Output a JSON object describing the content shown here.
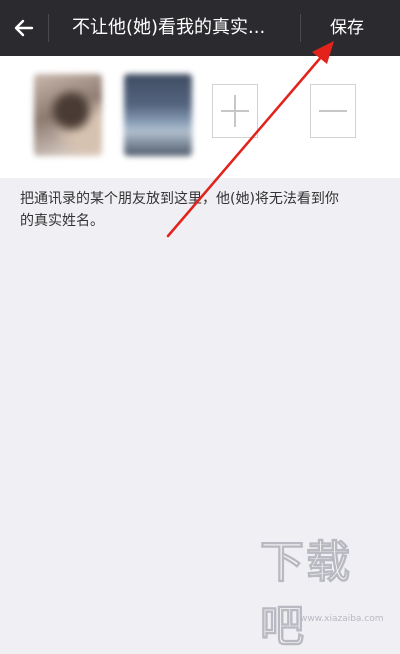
{
  "header": {
    "back_icon": "back-arrow-icon",
    "title": "不让他(她)看我的真实...",
    "save_label": "保存"
  },
  "members": {
    "avatars": [
      "contact-avatar",
      "contact-avatar"
    ],
    "add_icon": "plus-icon",
    "remove_icon": "minus-icon"
  },
  "description": {
    "line1": "把通讯录的某个朋友放到这里，他(她)将无法看到你",
    "line2": "的真实姓名。"
  },
  "watermark": {
    "text": "下载吧",
    "url": "www.xiazaiba.com"
  },
  "colors": {
    "topbar": "#2b2b2f",
    "background": "#efeff4",
    "annotation_arrow": "#e2221b"
  }
}
